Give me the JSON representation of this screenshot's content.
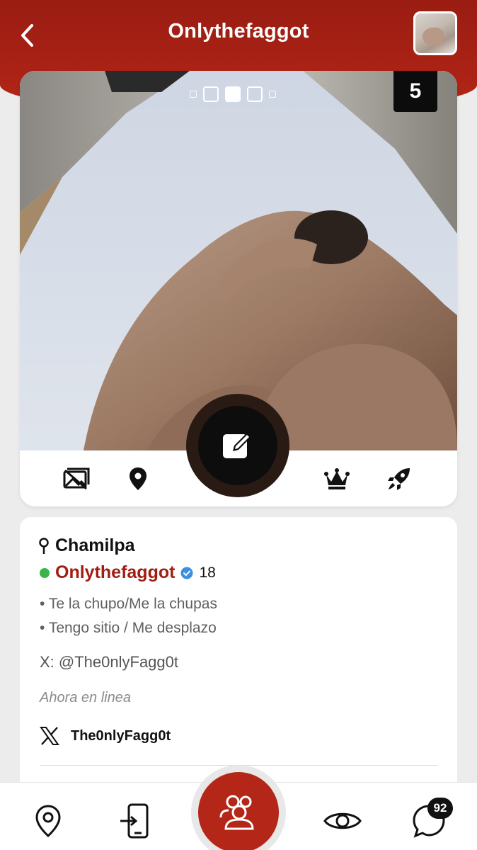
{
  "header": {
    "title": "Onlythefaggot",
    "back_icon": "chevron-left-icon",
    "avatar_icon": "profile-thumbnail"
  },
  "photo": {
    "count": "5",
    "carousel_active_index": 2,
    "carousel_total": 5
  },
  "actions": {
    "items": [
      "gallery-icon",
      "map-pin-icon",
      "edit-icon",
      "crown-icon",
      "rocket-icon"
    ]
  },
  "profile": {
    "location": "Chamilpa",
    "name": "Onlythefaggot",
    "age": "18",
    "verified": true,
    "online": true,
    "bullets": [
      "Te la chupo/Me la chupas",
      "Tengo sitio / Me desplazo"
    ],
    "handle": "X: @The0nlyFagg0t",
    "status": "Ahora en linea",
    "x_account": "The0nlyFagg0t"
  },
  "nav": {
    "items": [
      "location-icon",
      "login-icon",
      "people-icon",
      "eye-icon",
      "chat-icon"
    ],
    "chat_badge": "92"
  },
  "colors": {
    "brand_red": "#b42617",
    "name_red": "#a11d12",
    "online_green": "#3cb44b",
    "verified_blue": "#3d8fe0"
  }
}
